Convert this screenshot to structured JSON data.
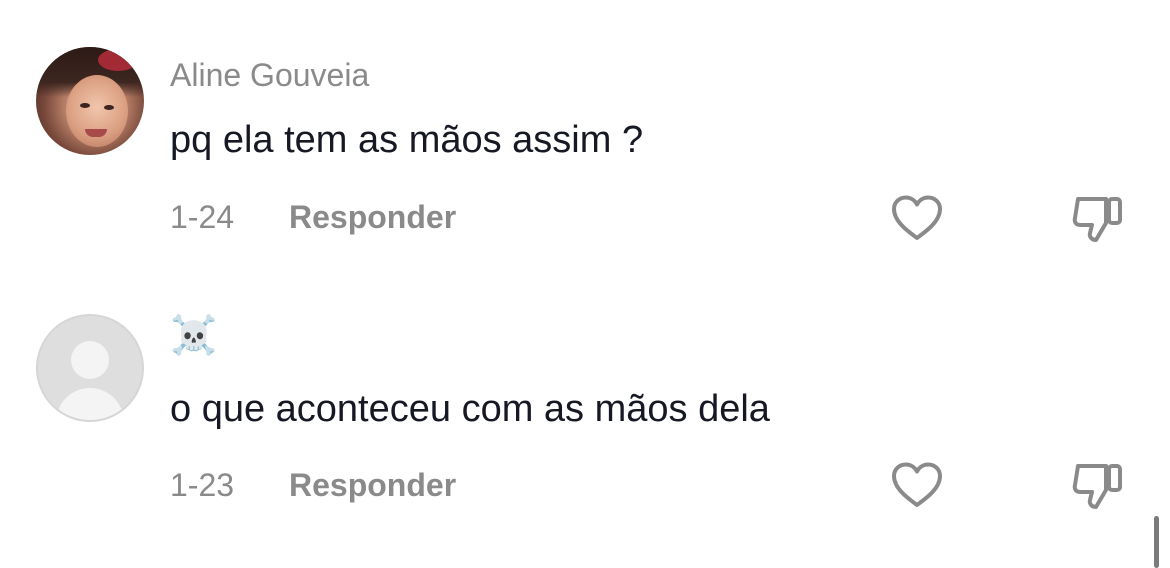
{
  "comments": [
    {
      "username": "Aline Gouveia",
      "text": "pq ela tem as mãos assim ?",
      "date": "1-24",
      "reply_label": "Responder",
      "avatar": "user-photo"
    },
    {
      "username": "☠️",
      "text": "o que aconteceu com as mãos dela",
      "date": "1-23",
      "reply_label": "Responder",
      "avatar": "default-avatar"
    }
  ],
  "icons": {
    "like": "heart-outline-icon",
    "dislike": "thumbs-down-outline-icon"
  },
  "colors": {
    "text_primary": "#161823",
    "text_secondary": "#8a8a8a",
    "background": "#ffffff"
  }
}
